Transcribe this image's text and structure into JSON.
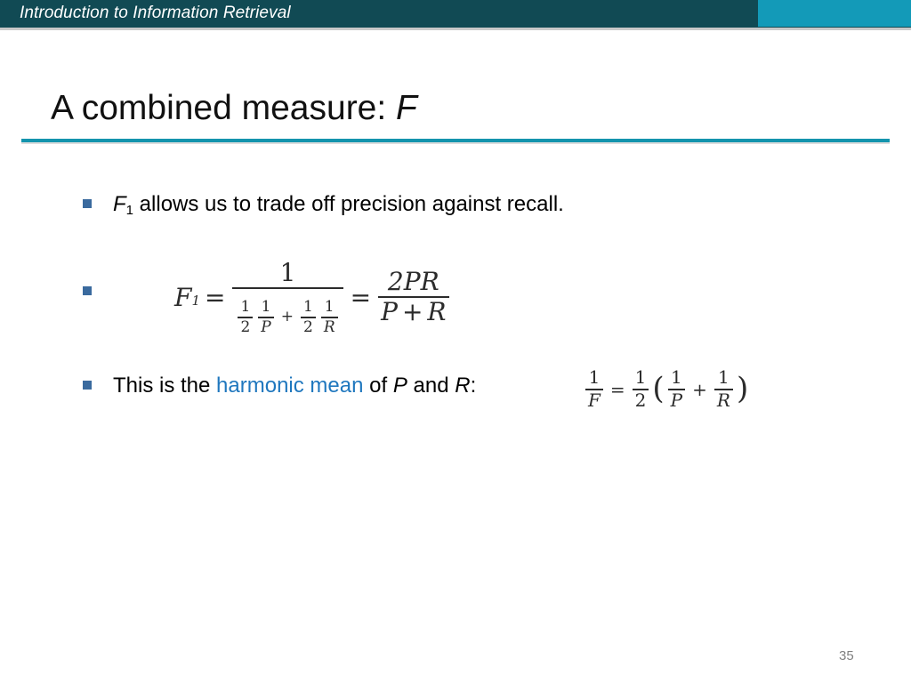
{
  "banner": {
    "title": "Introduction to Information Retrieval",
    "bg_color": "#114A54",
    "accent_color": "#139AB8"
  },
  "slide": {
    "title_main": "A combined measure: ",
    "title_italic": "F",
    "rule_color": "#1494AD",
    "page_number": "35"
  },
  "bullets": [
    {
      "id": "bullet-1",
      "marker": "square",
      "text_parts": {
        "var": "F",
        "subscript": "1",
        "rest": " allows us to trade off precision against recall."
      }
    },
    {
      "id": "bullet-2",
      "marker": "square",
      "text_parts": {
        "rest": ""
      }
    },
    {
      "id": "bullet-3",
      "marker": "square",
      "text_parts": {
        "lead": "This is the ",
        "highlight": "harmonic mean",
        "mid": " of ",
        "var1": "P",
        "and": " and ",
        "var2": "R",
        "colon": ":"
      }
    }
  ],
  "formula_main": {
    "lhs_var": "F",
    "lhs_sub": "1",
    "eq1": "=",
    "frac1_num": "1",
    "f_half_a_num": "1",
    "f_half_a_den": "2",
    "f_inv_p_num": "1",
    "f_inv_p_den": "P",
    "plus": "+",
    "f_half_b_num": "1",
    "f_half_b_den": "2",
    "f_inv_r_num": "1",
    "f_inv_r_den": "R",
    "eq2": "=",
    "frac2_num": "2PR",
    "frac2_den_p": "P",
    "frac2_den_plus": "+",
    "frac2_den_r": "R"
  },
  "formula_inline": {
    "lhs_num": "1",
    "lhs_den": "F",
    "eq": "=",
    "half_num": "1",
    "half_den": "2",
    "open_paren": "(",
    "inv_p_num": "1",
    "inv_p_den": "P",
    "plus": "+",
    "inv_r_num": "1",
    "inv_r_den": "R",
    "close_paren": ")"
  }
}
